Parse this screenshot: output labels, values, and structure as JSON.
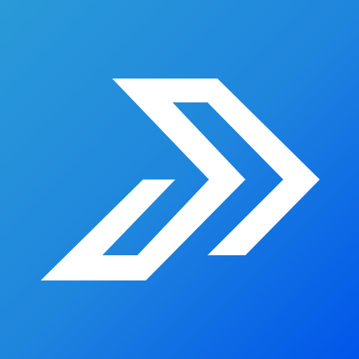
{
  "app_icon": {
    "icon": "double-chevron-right-logo-icon",
    "colors": {
      "gradient_start": "#2a9ad8",
      "gradient_mid": "#1f86dd",
      "gradient_end": "#0055ea",
      "glyph": "#ffffff"
    }
  }
}
